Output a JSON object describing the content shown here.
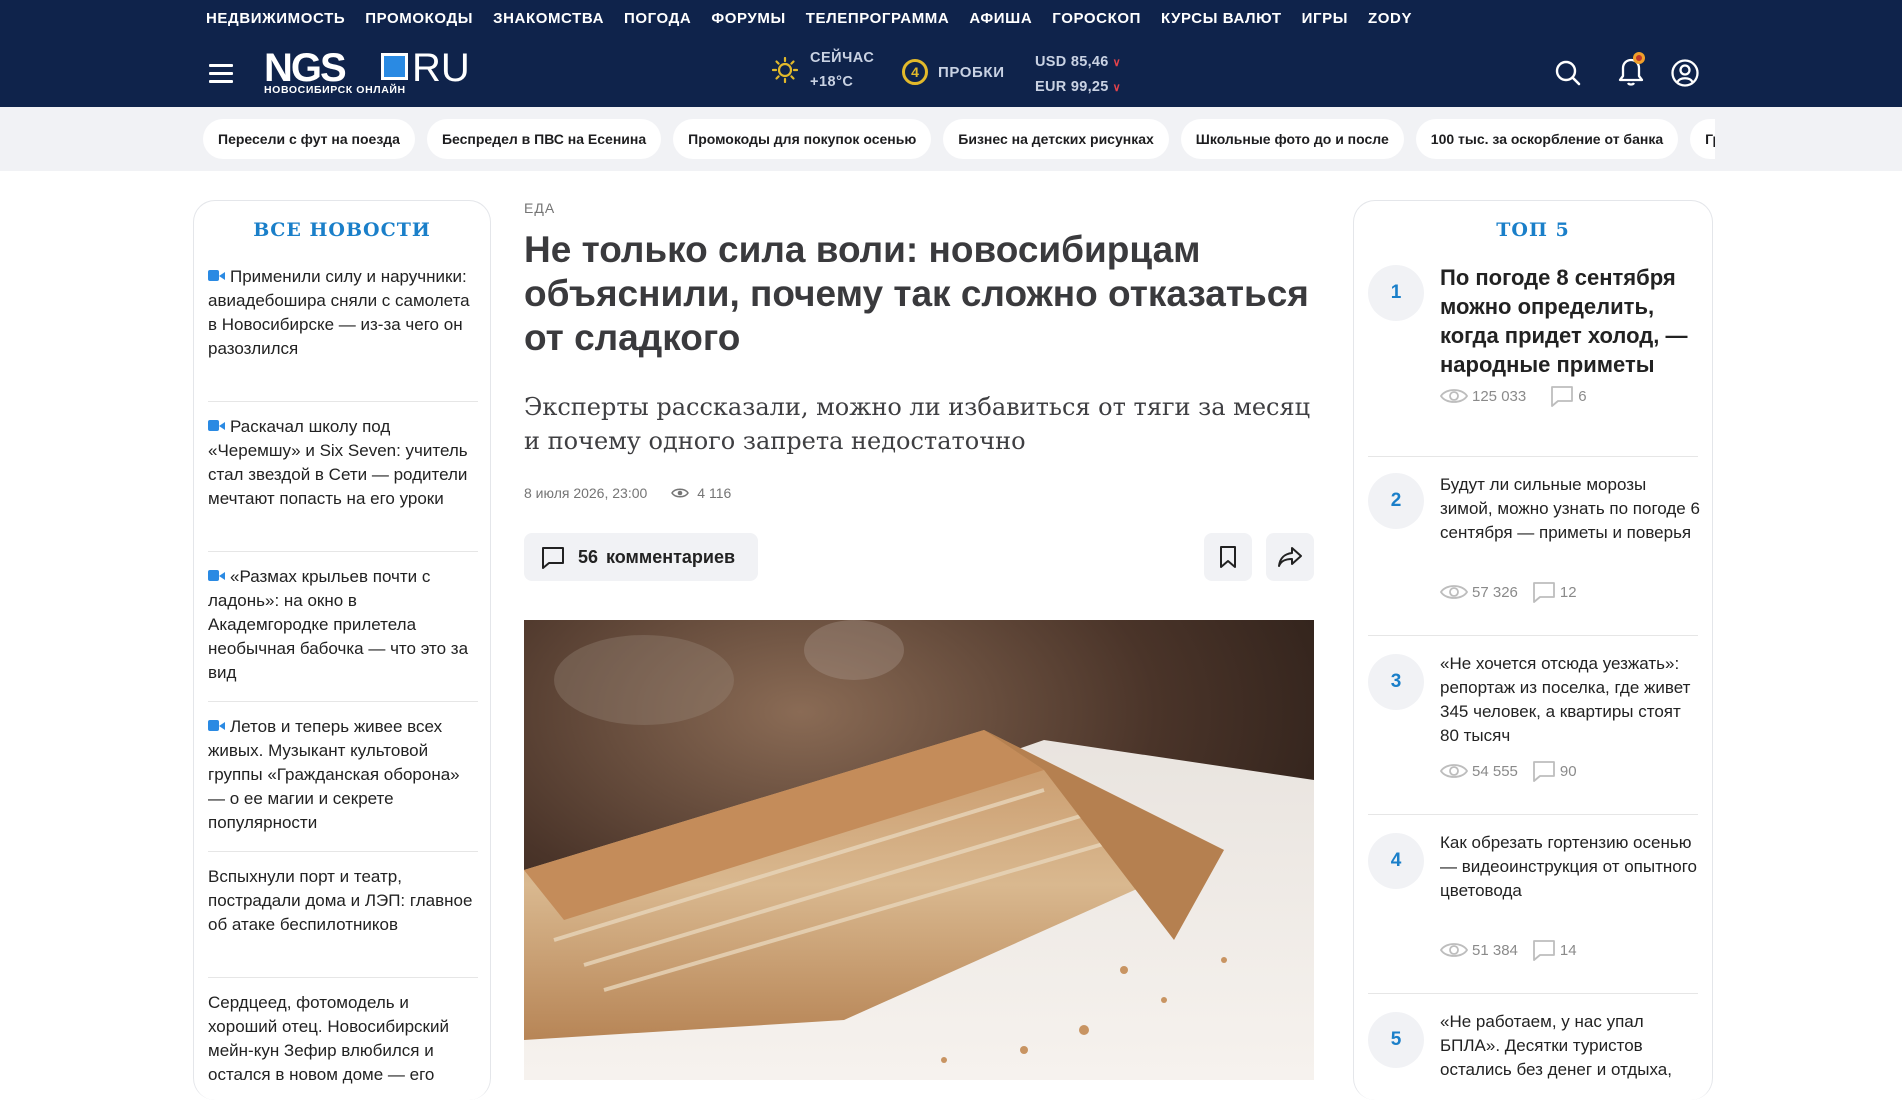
{
  "top_nav": [
    "НЕДВИЖИМОСТЬ",
    "ПРОМОКОДЫ",
    "ЗНАКОМСТВА",
    "ПОГОДА",
    "ФОРУМЫ",
    "ТЕЛЕПРОГРАММА",
    "АФИША",
    "ГОРОСКОП",
    "КУРСЫ ВАЛЮТ",
    "ИГРЫ",
    "ZODY"
  ],
  "logo": {
    "main": "NGS",
    "ru": "RU",
    "subtitle": "НОВОСИБИРСК ОНЛАЙН"
  },
  "weather": {
    "label": "СЕЙЧАС",
    "temp": "+18°C"
  },
  "traffic": {
    "level": "4",
    "label": "ПРОБКИ"
  },
  "rates": {
    "usd": "USD 85,46",
    "eur": "EUR 99,25"
  },
  "tags": [
    "Пересели с фут на поезда",
    "Беспредел в ПВС на Есенина",
    "Промокоды для покупок осенью",
    "Бизнес на детских рисунках",
    "Школьные фото до и после",
    "100 тыс. за оскорбление от банка",
    "Грибы осенью"
  ],
  "left": {
    "title": "ВСЕ НОВОСТИ",
    "items": [
      {
        "text": "Применили силу и наручники: авиадебошира сняли с самолета в Новосибирске — из-за чего он разозлился"
      },
      {
        "text": "Раскачал школу под «Черемшу» и Six Seven: учитель стал звездой в Сети — родители мечтают попасть на его уроки"
      },
      {
        "text": "«Размах крыльев почти с ладонь»: на окно в Академгородке прилетела необычная бабочка — что это за вид"
      },
      {
        "text": "Летов и теперь живее всех живых. Музыкант культовой группы «Гражданская оборона» — о ее магии и секрете популярности"
      },
      {
        "text": "Вспыхнули порт и театр, пострадали дома и ЛЭП: главное об атаке беспилотников"
      },
      {
        "text": "Сердцеед, фотомодель и хороший отец. Новосибирский мейн-кун Зефир влюбился и остался в новом доме — его"
      }
    ]
  },
  "article": {
    "rubric": "ЕДА",
    "title": "Не только сила воли: новосибирцам объяснили, почему так сложно отказаться от сладкого",
    "subtitle": "Эксперты рассказали, можно ли избавиться от тяги за месяц и почему одного запрета недостаточно",
    "date": "8 июля 2026, 23:00",
    "views": "4 116",
    "comments_count": "56",
    "comments_label": "комментариев"
  },
  "right": {
    "title": "ТОП 5",
    "items": [
      {
        "num": "1",
        "text": "По погоде 8 сентября можно определить, когда придет холод, — народные приметы",
        "views": "125 033",
        "comments": "6"
      },
      {
        "num": "2",
        "text": "Будут ли сильные морозы зимой, можно узнать по погоде 6 сентября — приметы и поверья",
        "views": "57 326",
        "comments": "12"
      },
      {
        "num": "3",
        "text": "«Не хочется отсюда уезжать»: репортаж из поселка, где живет 345 человек, а квартиры стоят 80 тысяч",
        "views": "54 555",
        "comments": "90"
      },
      {
        "num": "4",
        "text": "Как обрезать гортензию осенью — видеоинструкция от опытного цветовода",
        "views": "51 384",
        "comments": "14"
      },
      {
        "num": "5",
        "text": "«Не работаем, у нас упал БПЛА». Десятки туристов остались без денег и отдыха,"
      }
    ]
  }
}
